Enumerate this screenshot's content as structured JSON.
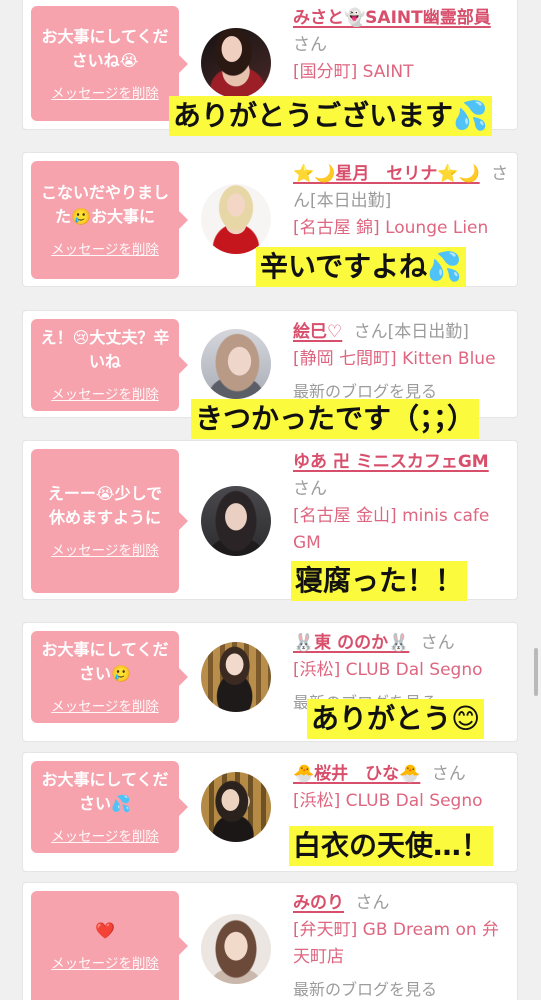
{
  "theme": {
    "page-bg": "#f0f0f0",
    "card-bg": "#ffffff",
    "bubble": "#f6a3ae",
    "name": "#d84f6c",
    "store": "#de6680",
    "muted": "#9c9c9c",
    "highlight": "#fbfa3c"
  },
  "labels": {
    "delete_message": "メッセージを削除",
    "honorific": "さん",
    "latest_blog": "最新のブログを見る"
  },
  "messages": [
    {
      "message": "お大事にしてくださいね😭",
      "cast": {
        "name": "みさと👻SAINT幽霊部員",
        "store": "[国分町] SAINT"
      },
      "reply_caption": "ありがとうございます💦"
    },
    {
      "message": "こないだやりました🥲お大事に",
      "cast": {
        "name": "⭐🌙星月　セリナ⭐🌙",
        "status": "[本日出勤]",
        "store": "[名古屋 錦] Lounge Lien"
      },
      "reply_caption": "辛いですよね💦"
    },
    {
      "message": "え！😢大丈夫？辛いね",
      "cast": {
        "name": "絵巳♡",
        "status": "[本日出勤]",
        "store": "[静岡 七間町] Kitten Blue"
      },
      "reply_caption": "きつかったです（；；）"
    },
    {
      "message": "えーー😭少しで休めますように",
      "cast": {
        "name": "ゆあ 卍 ミニスカフェGM",
        "store": "[名古屋 金山] minis cafe GM"
      },
      "reply_caption": "寝腐った！！"
    },
    {
      "message": "お大事にしてください🥲",
      "cast": {
        "name": "🐰東 ののか🐰",
        "store": "[浜松] CLUB Dal Segno"
      },
      "reply_caption": "ありがとう😊"
    },
    {
      "message": "お大事にしてください💦",
      "cast": {
        "name": "🐣桜井　ひな🐣",
        "store": "[浜松] CLUB Dal Segno"
      },
      "reply_caption": "白衣の天使…！"
    },
    {
      "message": "❤️",
      "cast": {
        "name": "みのり",
        "store": "[弁天町] GB Dream on 弁天町店"
      }
    }
  ]
}
